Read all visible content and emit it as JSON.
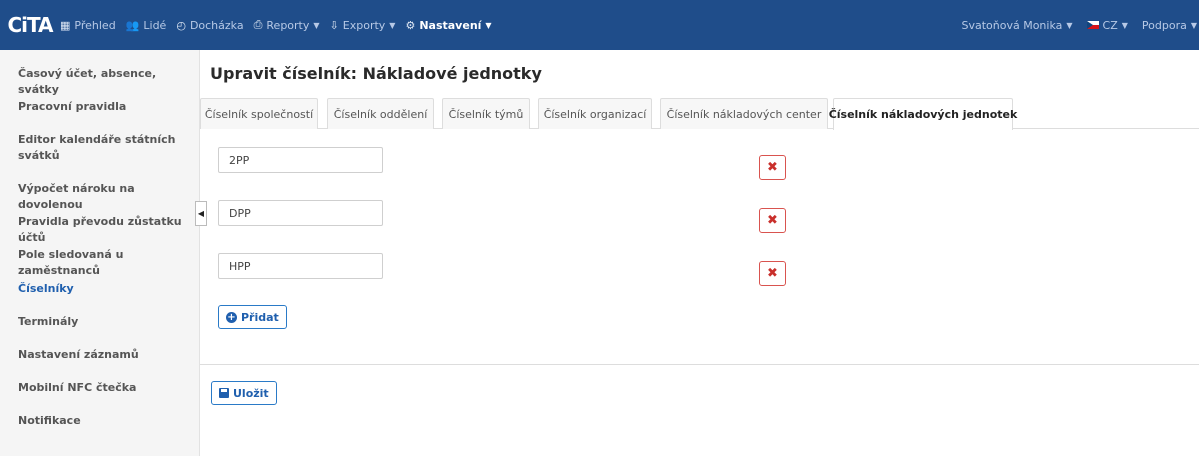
{
  "navbar": {
    "logo": "CiTA",
    "items": [
      {
        "icon": "grid-icon",
        "glyph": "▦",
        "label": "Přehled",
        "caret": false
      },
      {
        "icon": "people-icon",
        "glyph": "👥",
        "label": "Lidé",
        "caret": false
      },
      {
        "icon": "clock-icon",
        "glyph": "◴",
        "label": "Docházka",
        "caret": false
      },
      {
        "icon": "print-icon",
        "glyph": "⎙",
        "label": "Reporty",
        "caret": true
      },
      {
        "icon": "export-icon",
        "glyph": "⇩",
        "label": "Exporty",
        "caret": true
      },
      {
        "icon": "gear-icon",
        "glyph": "⚙",
        "label": "Nastavení",
        "caret": true
      }
    ],
    "user": "Svatoňová Monika",
    "language": "CZ",
    "support": "Podpora"
  },
  "sidebar": {
    "items": [
      {
        "label": "Časový účet, absence, svátky"
      },
      {
        "label": "Pracovní pravidla"
      },
      {
        "label": "Editor kalendáře státních svátků"
      },
      {
        "label": "Výpočet nároku na dovolenou"
      },
      {
        "label": "Pravidla převodu zůstatku účtů"
      },
      {
        "label": "Pole sledovaná u zaměstnanců"
      },
      {
        "label": "Číselníky"
      },
      {
        "label": "Terminály"
      },
      {
        "label": "Nastavení záznamů"
      },
      {
        "label": "Mobilní NFC čtečka"
      },
      {
        "label": "Notifikace"
      }
    ],
    "active_index": 6
  },
  "page": {
    "title": "Upravit číselník: Nákladové jednotky"
  },
  "tabs": [
    {
      "label": "Číselník společností"
    },
    {
      "label": "Číselník oddělení"
    },
    {
      "label": "Číselník týmů"
    },
    {
      "label": "Číselník organizací"
    },
    {
      "label": "Číselník nákladových center"
    },
    {
      "label": "Číselník nákladových jednotek"
    }
  ],
  "active_tab": 5,
  "entries": [
    {
      "value": "2PP"
    },
    {
      "value": "DPP"
    },
    {
      "value": "HPP"
    }
  ],
  "buttons": {
    "add_label": "Přidat",
    "save_label": "Uložit",
    "delete_glyph": "✖"
  },
  "colors": {
    "navbar": "#1f4d8a",
    "accent": "#1f5fae",
    "danger": "#d9534f"
  }
}
